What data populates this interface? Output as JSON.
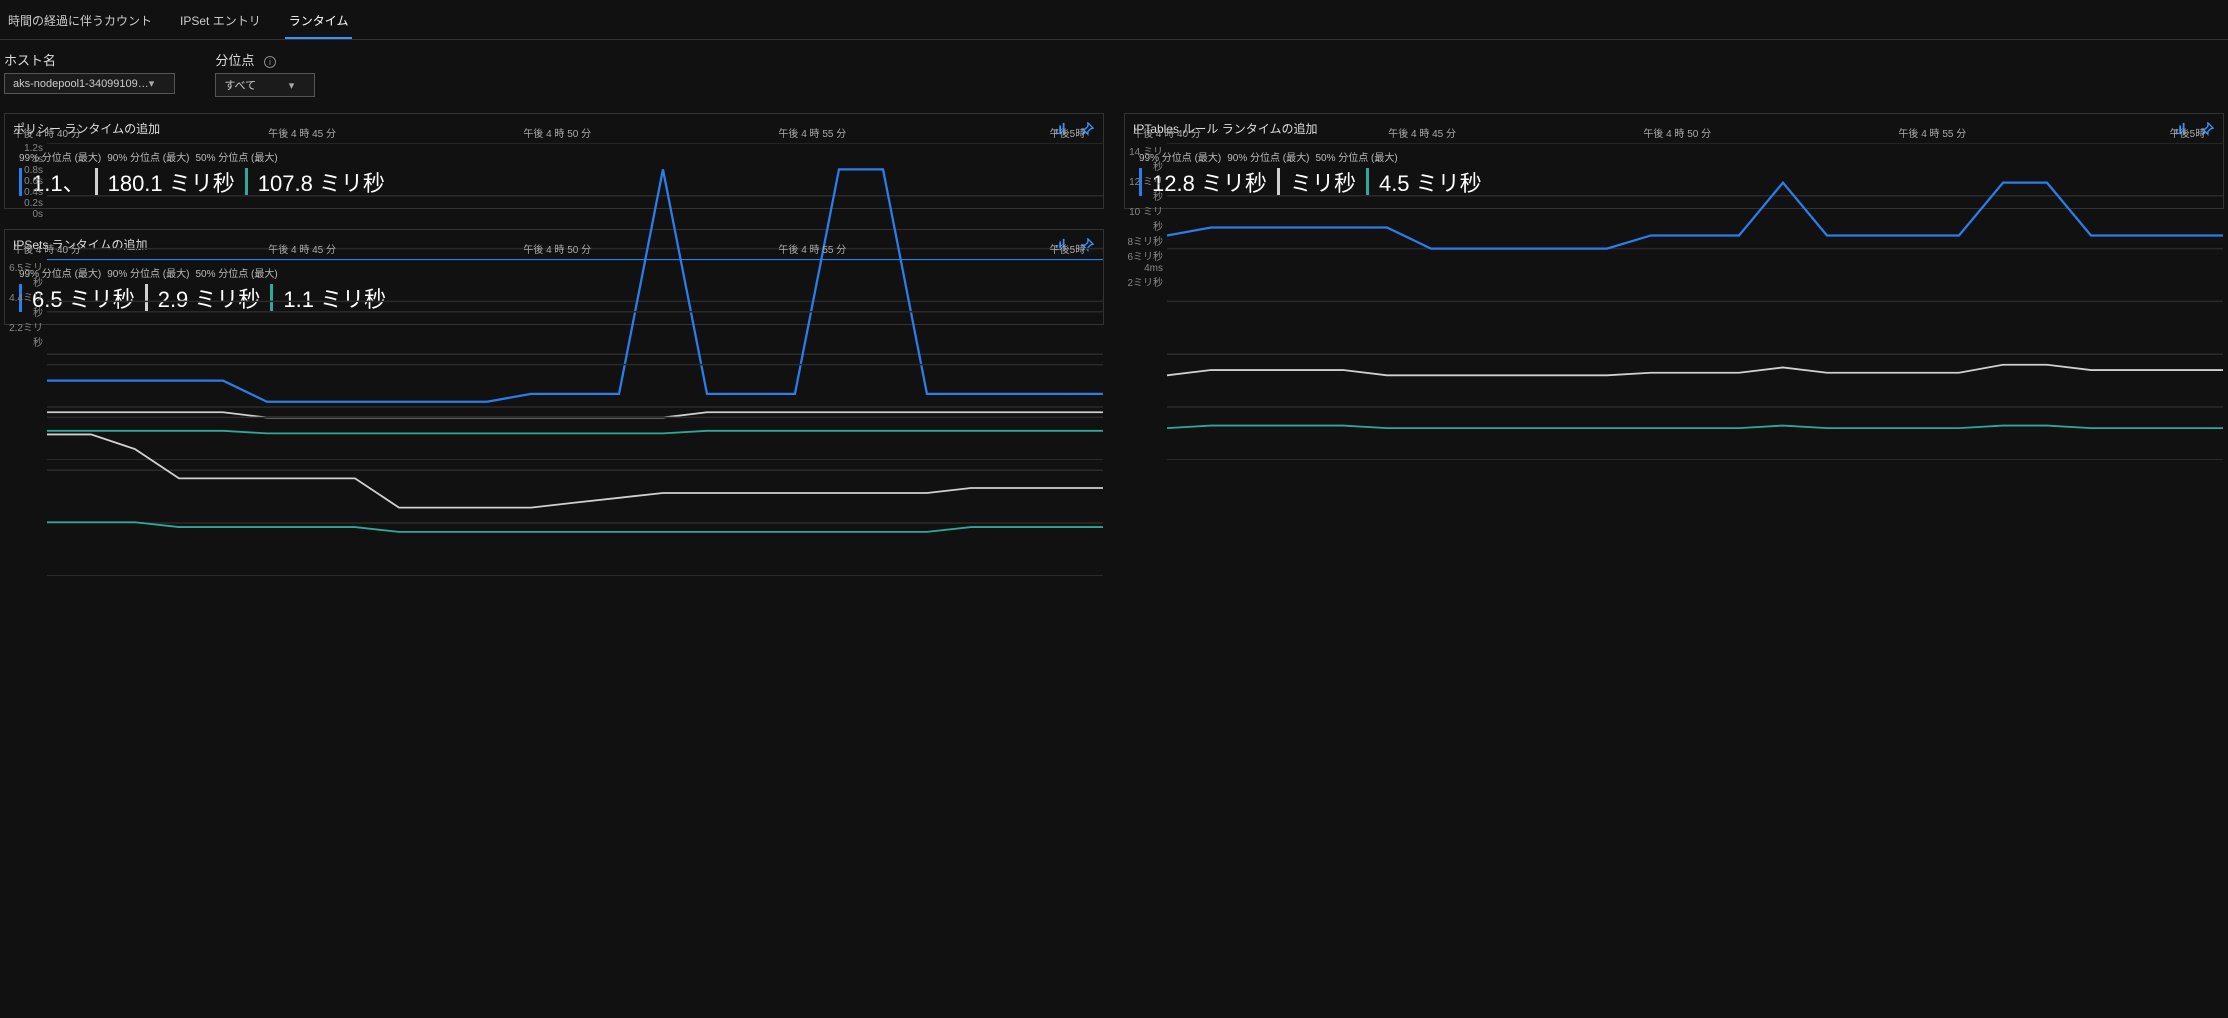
{
  "tabs": [
    {
      "label": "時間の経過に伴うカウント",
      "active": false
    },
    {
      "label": "IPSet エントリ",
      "active": false
    },
    {
      "label": "ランタイム",
      "active": true
    }
  ],
  "filters": {
    "host_label": "ホスト名",
    "host_value": "aks-nodepool1-34099109…",
    "quantile_label": "分位点",
    "quantile_value": "すべて"
  },
  "x_ticks": [
    "午後 4 時 40 分",
    "午後 4 時 45 分",
    "午後 4 時 50 分",
    "午後 4 時 55 分",
    "午後5時"
  ],
  "series_names": {
    "p99": "99% 分位点 (最大)",
    "p90": "90% 分位点 (最大)",
    "p50": "50% 分位点 (最大)"
  },
  "panels": [
    {
      "title": "ポリシー ランタイムの追加",
      "y_ticks": [
        "1.2s",
        "1s",
        "0.8s",
        "0.6s",
        "0.4s",
        "0.2s",
        "0s"
      ],
      "values": {
        "p99": "1.1、",
        "p90": "180.1 ミリ秒",
        "p50": "107.8 ミリ秒"
      }
    },
    {
      "title": "IPTables ルール ランタイムの追加",
      "y_ticks": [
        "14 ミリ秒",
        "12 ミリ秒",
        "10 ミリ秒",
        "8ミリ秒",
        "6ミリ秒",
        "4ms",
        "2ミリ秒"
      ],
      "values": {
        "p99": "12.8 ミリ秒",
        "p90": "ミリ秒",
        "p50": "4.5 ミリ秒"
      }
    },
    {
      "title": "IPSets ランタイムの追加",
      "y_ticks": [
        "6.5ミリ秒",
        "",
        "4.4ミリ秒",
        "",
        "2.2ミリ秒",
        "",
        ""
      ],
      "values": {
        "p99": "6.5 ミリ秒",
        "p90": "2.9 ミリ秒",
        "p50": "1.1 ミリ秒"
      }
    }
  ],
  "chart_data": [
    {
      "type": "line",
      "title": "ポリシー ランタイムの追加",
      "xlabel": "",
      "ylabel": "秒",
      "ylim": [
        0,
        1.2
      ],
      "x": [
        "16:40",
        "16:45",
        "16:50",
        "16:55",
        "17:00"
      ],
      "series": [
        {
          "name": "99% 分位点 (最大)",
          "values_dense": [
            0.3,
            0.3,
            0.3,
            0.3,
            0.3,
            0.22,
            0.22,
            0.22,
            0.22,
            0.22,
            0.22,
            0.25,
            0.25,
            0.25,
            1.1,
            0.25,
            0.25,
            0.25,
            1.1,
            1.1,
            0.25,
            0.25,
            0.25,
            0.25,
            0.25
          ]
        },
        {
          "name": "90% 分位点 (最大)",
          "values_dense": [
            0.18,
            0.18,
            0.18,
            0.18,
            0.18,
            0.16,
            0.16,
            0.16,
            0.16,
            0.16,
            0.16,
            0.16,
            0.16,
            0.16,
            0.16,
            0.18,
            0.18,
            0.18,
            0.18,
            0.18,
            0.18,
            0.18,
            0.18,
            0.18,
            0.18
          ]
        },
        {
          "name": "50% 分位点 (最大)",
          "values_dense": [
            0.11,
            0.11,
            0.11,
            0.11,
            0.11,
            0.1,
            0.1,
            0.1,
            0.1,
            0.1,
            0.1,
            0.1,
            0.1,
            0.1,
            0.1,
            0.11,
            0.11,
            0.11,
            0.11,
            0.11,
            0.11,
            0.11,
            0.11,
            0.11,
            0.11
          ]
        }
      ]
    },
    {
      "type": "line",
      "title": "IPTables ルール ランタイムの追加",
      "xlabel": "",
      "ylabel": "ミリ秒",
      "ylim": [
        2,
        14
      ],
      "x": [
        "16:40",
        "16:45",
        "16:50",
        "16:55",
        "17:00"
      ],
      "series": [
        {
          "name": "99% 分位点 (最大)",
          "values_dense": [
            10.5,
            10.8,
            10.8,
            10.8,
            10.8,
            10.8,
            10.0,
            10.0,
            10.0,
            10.0,
            10.0,
            10.5,
            10.5,
            10.5,
            12.5,
            10.5,
            10.5,
            10.5,
            10.5,
            12.5,
            12.5,
            10.5,
            10.5,
            10.5,
            10.5
          ]
        },
        {
          "name": "90% 分位点 (最大)",
          "values_dense": [
            5.2,
            5.4,
            5.4,
            5.4,
            5.4,
            5.2,
            5.2,
            5.2,
            5.2,
            5.2,
            5.2,
            5.3,
            5.3,
            5.3,
            5.5,
            5.3,
            5.3,
            5.3,
            5.3,
            5.6,
            5.6,
            5.4,
            5.4,
            5.4,
            5.4
          ]
        },
        {
          "name": "50% 分位点 (最大)",
          "values_dense": [
            3.2,
            3.3,
            3.3,
            3.3,
            3.3,
            3.2,
            3.2,
            3.2,
            3.2,
            3.2,
            3.2,
            3.2,
            3.2,
            3.2,
            3.3,
            3.2,
            3.2,
            3.2,
            3.2,
            3.3,
            3.3,
            3.2,
            3.2,
            3.2,
            3.2
          ]
        }
      ]
    },
    {
      "type": "line",
      "title": "IPSets ランタイムの追加",
      "xlabel": "",
      "ylabel": "ミリ秒",
      "ylim": [
        0,
        6.5
      ],
      "x": [
        "16:40",
        "16:45",
        "16:50",
        "16:55",
        "17:00"
      ],
      "series": [
        {
          "name": "99% 分位点 (最大)",
          "values_dense": [
            6.5,
            6.5,
            6.5,
            6.5,
            6.5,
            6.5,
            6.5,
            6.5,
            6.5,
            6.5,
            6.5,
            6.5,
            6.5,
            6.5,
            6.5,
            6.5,
            6.5,
            6.5,
            6.5,
            6.5,
            6.5,
            6.5,
            6.5,
            6.5,
            6.5
          ]
        },
        {
          "name": "90% 分位点 (最大)",
          "values_dense": [
            2.9,
            2.9,
            2.6,
            2.0,
            2.0,
            2.0,
            2.0,
            2.0,
            1.4,
            1.4,
            1.4,
            1.4,
            1.5,
            1.6,
            1.7,
            1.7,
            1.7,
            1.7,
            1.7,
            1.7,
            1.7,
            1.8,
            1.8,
            1.8,
            1.8
          ]
        },
        {
          "name": "50% 分位点 (最大)",
          "values_dense": [
            1.1,
            1.1,
            1.1,
            1.0,
            1.0,
            1.0,
            1.0,
            1.0,
            0.9,
            0.9,
            0.9,
            0.9,
            0.9,
            0.9,
            0.9,
            0.9,
            0.9,
            0.9,
            0.9,
            0.9,
            0.9,
            1.0,
            1.0,
            1.0,
            1.0
          ]
        }
      ]
    }
  ]
}
